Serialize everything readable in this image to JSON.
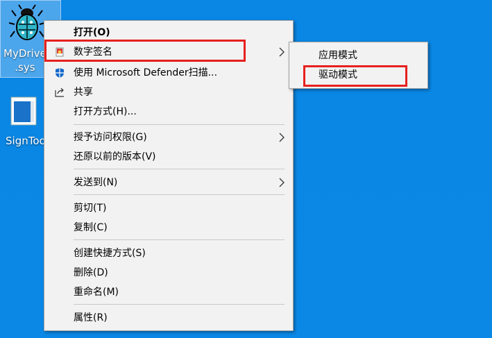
{
  "desktop": {
    "icons": [
      {
        "label": "MyDrive",
        "label2": ".sys",
        "icon": "bug-icon"
      },
      {
        "label": "SignToo",
        "icon": "signtool-icon"
      }
    ]
  },
  "context_menu": {
    "items": [
      {
        "label": "打开(O)",
        "bold": true
      },
      {
        "label": "数字签名",
        "icon": "certificate-icon",
        "submenu": true
      },
      {
        "label": "使用 Microsoft Defender扫描...",
        "icon": "defender-shield-icon"
      },
      {
        "label": "共享",
        "icon": "share-icon"
      },
      {
        "label": "打开方式(H)..."
      },
      {
        "label": "授予访问权限(G)",
        "submenu": true
      },
      {
        "label": "还原以前的版本(V)"
      },
      {
        "label": "发送到(N)",
        "submenu": true
      },
      {
        "label": "剪切(T)"
      },
      {
        "label": "复制(C)"
      },
      {
        "label": "创建快捷方式(S)"
      },
      {
        "label": "删除(D)"
      },
      {
        "label": "重命名(M)"
      },
      {
        "label": "属性(R)"
      }
    ]
  },
  "submenu": {
    "items": [
      {
        "label": "应用模式"
      },
      {
        "label": "驱动模式"
      }
    ]
  },
  "colors": {
    "desktop": "#0b86e3",
    "highlight_border": "#e6201e",
    "menu_bg": "#f2f2f2"
  }
}
